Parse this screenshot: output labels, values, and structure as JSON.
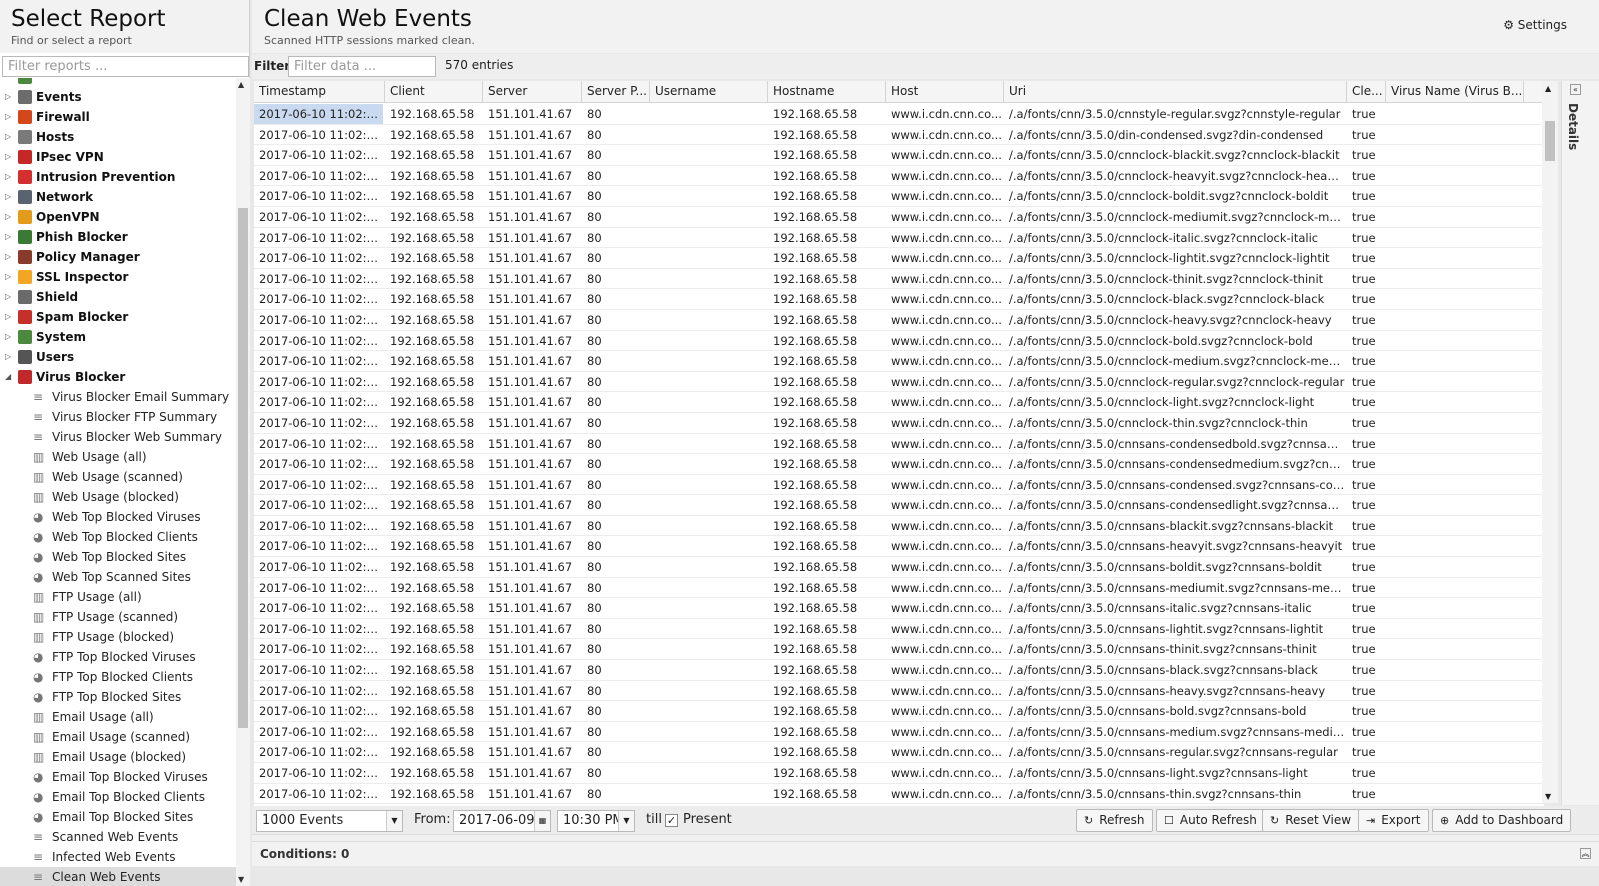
{
  "left": {
    "title": "Select Report",
    "subtitle": "Find or select a report",
    "filter_placeholder": "Filter reports ...",
    "categories": [
      {
        "label": "Events",
        "color": "#6c6c6c"
      },
      {
        "label": "Firewall",
        "color": "#d4461b"
      },
      {
        "label": "Hosts",
        "color": "#7a7a7a"
      },
      {
        "label": "IPsec VPN",
        "color": "#c62828"
      },
      {
        "label": "Intrusion Prevention",
        "color": "#d32f2f"
      },
      {
        "label": "Network",
        "color": "#5a6470"
      },
      {
        "label": "OpenVPN",
        "color": "#e39b1c"
      },
      {
        "label": "Phish Blocker",
        "color": "#3a7a34"
      },
      {
        "label": "Policy Manager",
        "color": "#8a3a2a"
      },
      {
        "label": "SSL Inspector",
        "color": "#f2a623"
      },
      {
        "label": "Shield",
        "color": "#6a6a6a"
      },
      {
        "label": "Spam Blocker",
        "color": "#c6302a"
      },
      {
        "label": "System",
        "color": "#4b8a3e"
      },
      {
        "label": "Users",
        "color": "#555555"
      },
      {
        "label": "Virus Blocker",
        "color": "#c0282a"
      }
    ],
    "reports": [
      {
        "label": "Virus Blocker Email Summary",
        "icon": "≡"
      },
      {
        "label": "Virus Blocker FTP Summary",
        "icon": "≡"
      },
      {
        "label": "Virus Blocker Web Summary",
        "icon": "≡"
      },
      {
        "label": "Web Usage (all)",
        "icon": "▥"
      },
      {
        "label": "Web Usage (scanned)",
        "icon": "▥"
      },
      {
        "label": "Web Usage (blocked)",
        "icon": "▥"
      },
      {
        "label": "Web Top Blocked Viruses",
        "icon": "◕"
      },
      {
        "label": "Web Top Blocked Clients",
        "icon": "◕"
      },
      {
        "label": "Web Top Blocked Sites",
        "icon": "◕"
      },
      {
        "label": "Web Top Scanned Sites",
        "icon": "◕"
      },
      {
        "label": "FTP Usage (all)",
        "icon": "▥"
      },
      {
        "label": "FTP Usage (scanned)",
        "icon": "▥"
      },
      {
        "label": "FTP Usage (blocked)",
        "icon": "▥"
      },
      {
        "label": "FTP Top Blocked Viruses",
        "icon": "◕"
      },
      {
        "label": "FTP Top Blocked Clients",
        "icon": "◕"
      },
      {
        "label": "FTP Top Blocked Sites",
        "icon": "◕"
      },
      {
        "label": "Email Usage (all)",
        "icon": "▥"
      },
      {
        "label": "Email Usage (scanned)",
        "icon": "▥"
      },
      {
        "label": "Email Usage (blocked)",
        "icon": "▥"
      },
      {
        "label": "Email Top Blocked Viruses",
        "icon": "◕"
      },
      {
        "label": "Email Top Blocked Clients",
        "icon": "◕"
      },
      {
        "label": "Email Top Blocked Sites",
        "icon": "◕"
      },
      {
        "label": "Scanned Web Events",
        "icon": "≡"
      },
      {
        "label": "Infected Web Events",
        "icon": "≡"
      },
      {
        "label": "Clean Web Events",
        "icon": "≡",
        "selected": true
      }
    ]
  },
  "main": {
    "title": "Clean Web Events",
    "subtitle": "Scanned HTTP sessions marked clean.",
    "settings_label": "Settings",
    "filter_label": "Filter:",
    "filter_placeholder": "Filter data ...",
    "entries_text": "570 entries",
    "details_label": "Details"
  },
  "grid": {
    "columns": [
      "Timestamp",
      "Client",
      "Server",
      "Server P...",
      "Username",
      "Hostname",
      "Host",
      "Uri",
      "Cle...",
      "Virus Name (Virus B..."
    ],
    "common": {
      "client": "192.168.65.58",
      "server": "151.101.41.67",
      "port": "80",
      "username": "",
      "hostname": "192.168.65.58",
      "host": "www.i.cdn.cnn.co...",
      "clean": "true",
      "virus": ""
    },
    "rows": [
      {
        "ts": "2017-06-10 11:02:5...",
        "uri": "/.a/fonts/cnn/3.5.0/cnnstyle-regular.svgz?cnnstyle-regular"
      },
      {
        "ts": "2017-06-10 11:02:5...",
        "uri": "/.a/fonts/cnn/3.5.0/din-condensed.svgz?din-condensed"
      },
      {
        "ts": "2017-06-10 11:02:5...",
        "uri": "/.a/fonts/cnn/3.5.0/cnnclock-blackit.svgz?cnnclock-blackit"
      },
      {
        "ts": "2017-06-10 11:02:5...",
        "uri": "/.a/fonts/cnn/3.5.0/cnnclock-heavyit.svgz?cnnclock-heavyit"
      },
      {
        "ts": "2017-06-10 11:02:5...",
        "uri": "/.a/fonts/cnn/3.5.0/cnnclock-boldit.svgz?cnnclock-boldit"
      },
      {
        "ts": "2017-06-10 11:02:5...",
        "uri": "/.a/fonts/cnn/3.5.0/cnnclock-mediumit.svgz?cnnclock-med..."
      },
      {
        "ts": "2017-06-10 11:02:5...",
        "uri": "/.a/fonts/cnn/3.5.0/cnnclock-italic.svgz?cnnclock-italic"
      },
      {
        "ts": "2017-06-10 11:02:5...",
        "uri": "/.a/fonts/cnn/3.5.0/cnnclock-lightit.svgz?cnnclock-lightit"
      },
      {
        "ts": "2017-06-10 11:02:5...",
        "uri": "/.a/fonts/cnn/3.5.0/cnnclock-thinit.svgz?cnnclock-thinit"
      },
      {
        "ts": "2017-06-10 11:02:5...",
        "uri": "/.a/fonts/cnn/3.5.0/cnnclock-black.svgz?cnnclock-black"
      },
      {
        "ts": "2017-06-10 11:02:5...",
        "uri": "/.a/fonts/cnn/3.5.0/cnnclock-heavy.svgz?cnnclock-heavy"
      },
      {
        "ts": "2017-06-10 11:02:5...",
        "uri": "/.a/fonts/cnn/3.5.0/cnnclock-bold.svgz?cnnclock-bold"
      },
      {
        "ts": "2017-06-10 11:02:5...",
        "uri": "/.a/fonts/cnn/3.5.0/cnnclock-medium.svgz?cnnclock-mediu..."
      },
      {
        "ts": "2017-06-10 11:02:5...",
        "uri": "/.a/fonts/cnn/3.5.0/cnnclock-regular.svgz?cnnclock-regular"
      },
      {
        "ts": "2017-06-10 11:02:5...",
        "uri": "/.a/fonts/cnn/3.5.0/cnnclock-light.svgz?cnnclock-light"
      },
      {
        "ts": "2017-06-10 11:02:5...",
        "uri": "/.a/fonts/cnn/3.5.0/cnnclock-thin.svgz?cnnclock-thin"
      },
      {
        "ts": "2017-06-10 11:02:5...",
        "uri": "/.a/fonts/cnn/3.5.0/cnnsans-condensedbold.svgz?cnnsans..."
      },
      {
        "ts": "2017-06-10 11:02:4...",
        "uri": "/.a/fonts/cnn/3.5.0/cnnsans-condensedmedium.svgz?cnn..."
      },
      {
        "ts": "2017-06-10 11:02:4...",
        "uri": "/.a/fonts/cnn/3.5.0/cnnsans-condensed.svgz?cnnsans-con..."
      },
      {
        "ts": "2017-06-10 11:02:4...",
        "uri": "/.a/fonts/cnn/3.5.0/cnnsans-condensedlight.svgz?cnnsans..."
      },
      {
        "ts": "2017-06-10 11:02:4...",
        "uri": "/.a/fonts/cnn/3.5.0/cnnsans-blackit.svgz?cnnsans-blackit"
      },
      {
        "ts": "2017-06-10 11:02:4...",
        "uri": "/.a/fonts/cnn/3.5.0/cnnsans-heavyit.svgz?cnnsans-heavyit"
      },
      {
        "ts": "2017-06-10 11:02:4...",
        "uri": "/.a/fonts/cnn/3.5.0/cnnsans-boldit.svgz?cnnsans-boldit"
      },
      {
        "ts": "2017-06-10 11:02:4...",
        "uri": "/.a/fonts/cnn/3.5.0/cnnsans-mediumit.svgz?cnnsans-med..."
      },
      {
        "ts": "2017-06-10 11:02:4...",
        "uri": "/.a/fonts/cnn/3.5.0/cnnsans-italic.svgz?cnnsans-italic"
      },
      {
        "ts": "2017-06-10 11:02:4...",
        "uri": "/.a/fonts/cnn/3.5.0/cnnsans-lightit.svgz?cnnsans-lightit"
      },
      {
        "ts": "2017-06-10 11:02:4...",
        "uri": "/.a/fonts/cnn/3.5.0/cnnsans-thinit.svgz?cnnsans-thinit"
      },
      {
        "ts": "2017-06-10 11:02:4...",
        "uri": "/.a/fonts/cnn/3.5.0/cnnsans-black.svgz?cnnsans-black"
      },
      {
        "ts": "2017-06-10 11:02:4...",
        "uri": "/.a/fonts/cnn/3.5.0/cnnsans-heavy.svgz?cnnsans-heavy"
      },
      {
        "ts": "2017-06-10 11:02:4...",
        "uri": "/.a/fonts/cnn/3.5.0/cnnsans-bold.svgz?cnnsans-bold"
      },
      {
        "ts": "2017-06-10 11:02:4...",
        "uri": "/.a/fonts/cnn/3.5.0/cnnsans-medium.svgz?cnnsans-mediu..."
      },
      {
        "ts": "2017-06-10 11:02:4...",
        "uri": "/.a/fonts/cnn/3.5.0/cnnsans-regular.svgz?cnnsans-regular"
      },
      {
        "ts": "2017-06-10 11:02:4...",
        "uri": "/.a/fonts/cnn/3.5.0/cnnsans-light.svgz?cnnsans-light"
      },
      {
        "ts": "2017-06-10 11:02:4...",
        "uri": "/.a/fonts/cnn/3.5.0/cnnsans-thin.svgz?cnnsans-thin"
      }
    ]
  },
  "toolbar": {
    "limit_value": "1000 Events",
    "from_label": "From:",
    "from_date": "2017-06-09",
    "from_time": "10:30 PM",
    "till_label": "till",
    "present_label": "Present",
    "present_checked": true,
    "refresh_label": "Refresh",
    "auto_refresh_label": "Auto Refresh",
    "reset_view_label": "Reset View",
    "export_label": "Export",
    "add_dashboard_label": "Add to Dashboard"
  },
  "conditions": {
    "label": "Conditions: 0"
  }
}
